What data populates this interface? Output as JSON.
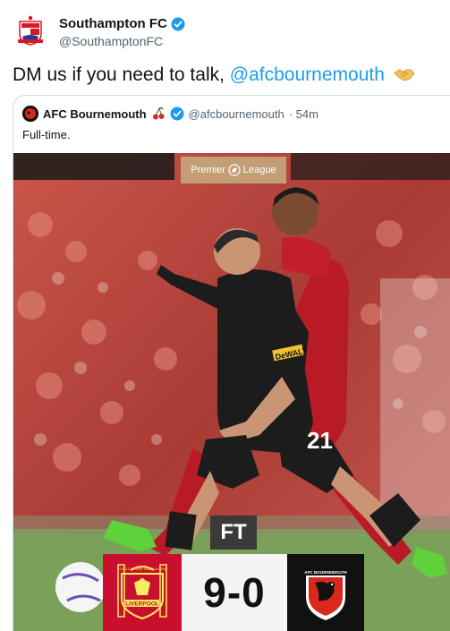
{
  "tweet": {
    "author_name": "Southampton FC",
    "author_handle": "@SouthamptonFC",
    "text_prefix": "DM us if you need to talk, ",
    "mention": "@afcbournemouth",
    "emoji_icon": "handshake-icon"
  },
  "quoted_tweet": {
    "author_name": "AFC Bournemouth",
    "author_handle": "@afcbournemouth",
    "time": "· 54m",
    "text": "Full-time.",
    "emoji_icon": "cherries-icon"
  },
  "media": {
    "competition": "Premier League",
    "competition_prefix": "Premier",
    "competition_suffix": "League",
    "status": "FT",
    "score": "9-0",
    "home_crest": "liverpool-crest",
    "away_crest": "bournemouth-crest",
    "home_crest_text": "LIVERPOOL",
    "home_crest_motto": "YOU'LL NEVER WALK ALONE",
    "away_crest_text": "AFC BOURNEMOUTH",
    "shirt_sponsor": "DeWALT",
    "shirt_number": "21",
    "colors": {
      "liverpool_red": "#c8102e",
      "bournemouth_black": "#111111",
      "twitter_blue": "#1d9bf0",
      "pl_gold": "#c4ad80"
    }
  }
}
